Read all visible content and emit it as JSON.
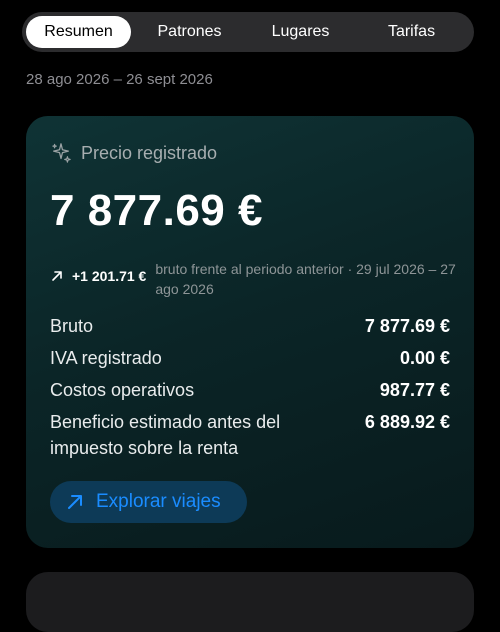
{
  "tabs": [
    {
      "label": "Resumen",
      "selected": true
    },
    {
      "label": "Patrones",
      "selected": false
    },
    {
      "label": "Lugares",
      "selected": false
    },
    {
      "label": "Tarifas",
      "selected": false
    }
  ],
  "date_range": "28 ago 2026 – 26 sept 2026",
  "card": {
    "icon": "sparkle-icon",
    "title": "Precio registrado",
    "amount": "7 877.69 €",
    "delta": {
      "icon": "arrow-up-right-icon",
      "value": "+1 201.71 €",
      "note": "bruto frente al periodo anterior · 29 jul 2026 – 27 ago 2026"
    },
    "rows": [
      {
        "label": "Bruto",
        "value": "7 877.69 €"
      },
      {
        "label": "IVA registrado",
        "value": "0.00 €"
      },
      {
        "label": "Costos operativos",
        "value": "987.77 €"
      },
      {
        "label": "Beneficio estimado antes del impuesto sobre la renta",
        "value": "6 889.92 €"
      }
    ],
    "button": {
      "label": "Explorar viajes",
      "icon": "arrow-up-right-icon"
    }
  },
  "colors": {
    "background": "#000000",
    "card_bg": "#0b2527",
    "accent": "#1a8cff",
    "button_bg": "#0d3a57",
    "muted_text": "#8e8e93"
  }
}
